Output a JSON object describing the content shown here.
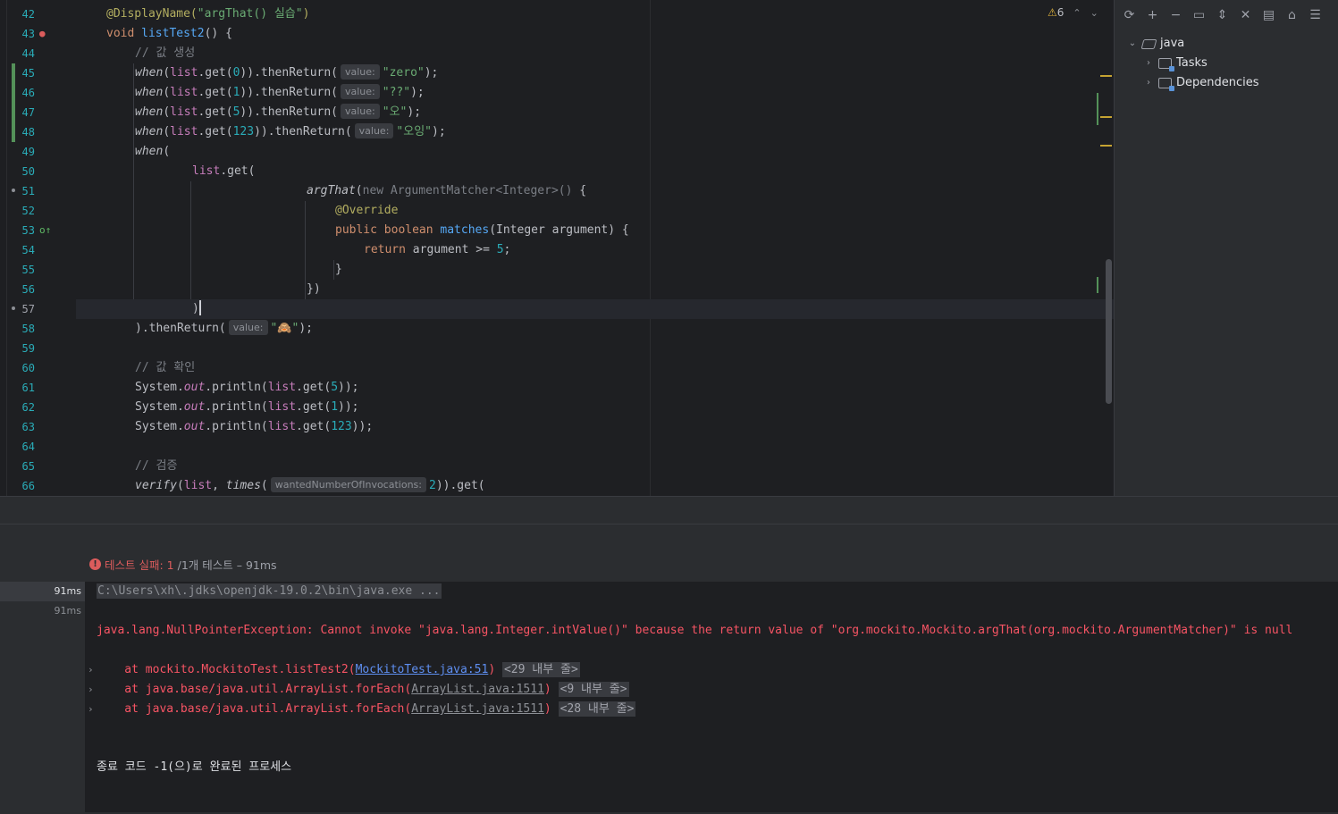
{
  "editor": {
    "lines": [
      {
        "n": "42",
        "html_parts": [
          [
            "ann",
            "@DisplayName("
          ],
          [
            "str",
            "\"argThat() 실습\""
          ],
          [
            "ann",
            ")"
          ]
        ],
        "indent": 34
      },
      {
        "n": "43",
        "html_parts": [
          [
            "kw",
            "void "
          ],
          [
            "fn",
            "listTest2"
          ],
          [
            "",
            "() {"
          ]
        ],
        "indent": 34
      },
      {
        "n": "44",
        "html_parts": [
          [
            "cmt",
            "// 값 생성"
          ]
        ],
        "indent": 66
      },
      {
        "n": "45",
        "html_parts": [
          [
            "it",
            "when"
          ],
          [
            "",
            "("
          ],
          [
            "fld",
            "list"
          ],
          [
            "",
            ".get("
          ],
          [
            "num",
            "0"
          ],
          [
            "",
            ")).thenReturn("
          ],
          [
            "hint",
            "value:"
          ],
          [
            "str",
            "\"zero\""
          ],
          [
            "",
            ");"
          ]
        ],
        "indent": 66
      },
      {
        "n": "46",
        "html_parts": [
          [
            "it",
            "when"
          ],
          [
            "",
            "("
          ],
          [
            "fld",
            "list"
          ],
          [
            "",
            ".get("
          ],
          [
            "num",
            "1"
          ],
          [
            "",
            ")).thenReturn("
          ],
          [
            "hint",
            "value:"
          ],
          [
            "str",
            "\"??\""
          ],
          [
            "",
            ");"
          ]
        ],
        "indent": 66
      },
      {
        "n": "47",
        "html_parts": [
          [
            "it",
            "when"
          ],
          [
            "",
            "("
          ],
          [
            "fld",
            "list"
          ],
          [
            "",
            ".get("
          ],
          [
            "num",
            "5"
          ],
          [
            "",
            ")).thenReturn("
          ],
          [
            "hint",
            "value:"
          ],
          [
            "str",
            "\"오\""
          ],
          [
            "",
            ");"
          ]
        ],
        "indent": 66
      },
      {
        "n": "48",
        "html_parts": [
          [
            "it",
            "when"
          ],
          [
            "",
            "("
          ],
          [
            "fld",
            "list"
          ],
          [
            "",
            ".get("
          ],
          [
            "num",
            "123"
          ],
          [
            "",
            ")).thenReturn("
          ],
          [
            "hint",
            "value:"
          ],
          [
            "str",
            "\"오잉\""
          ],
          [
            "",
            ");"
          ]
        ],
        "indent": 66
      },
      {
        "n": "49",
        "html_parts": [
          [
            "it",
            "when"
          ],
          [
            "",
            "("
          ]
        ],
        "indent": 66
      },
      {
        "n": "50",
        "html_parts": [
          [
            "fld",
            "list"
          ],
          [
            "",
            ".get("
          ]
        ],
        "indent": 130
      },
      {
        "n": "51",
        "html_parts": [
          [
            "it",
            "argThat"
          ],
          [
            "",
            "("
          ],
          [
            "cmt",
            "new ArgumentMatcher<Integer>()"
          ],
          [
            "",
            " {"
          ]
        ],
        "indent": 258
      },
      {
        "n": "52",
        "html_parts": [
          [
            "ann",
            "@Override"
          ]
        ],
        "indent": 290
      },
      {
        "n": "53",
        "html_parts": [
          [
            "kw",
            "public boolean "
          ],
          [
            "fn",
            "matches"
          ],
          [
            "",
            "(Integer argument) {"
          ]
        ],
        "indent": 290
      },
      {
        "n": "54",
        "html_parts": [
          [
            "kw",
            "return "
          ],
          [
            "",
            "argument >= "
          ],
          [
            "num",
            "5"
          ],
          [
            "",
            ";"
          ]
        ],
        "indent": 322
      },
      {
        "n": "55",
        "html_parts": [
          [
            "",
            "}"
          ]
        ],
        "indent": 290
      },
      {
        "n": "56",
        "html_parts": [
          [
            "",
            "})"
          ]
        ],
        "indent": 258
      },
      {
        "n": "57",
        "html_parts": [
          [
            "",
            ")"
          ],
          [
            "caret",
            ""
          ]
        ],
        "indent": 130
      },
      {
        "n": "58",
        "html_parts": [
          [
            "",
            ").thenReturn("
          ],
          [
            "hint",
            "value:"
          ],
          [
            "str",
            "\"🙈\""
          ],
          [
            "",
            ");"
          ]
        ],
        "indent": 66
      },
      {
        "n": "59",
        "html_parts": [],
        "indent": 66
      },
      {
        "n": "60",
        "html_parts": [
          [
            "cmt",
            "// 값 확인"
          ]
        ],
        "indent": 66
      },
      {
        "n": "61",
        "html_parts": [
          [
            "",
            "System."
          ],
          [
            "fld it",
            "out"
          ],
          [
            "",
            ".println("
          ],
          [
            "fld",
            "list"
          ],
          [
            "",
            ".get("
          ],
          [
            "num",
            "5"
          ],
          [
            "",
            "));"
          ]
        ],
        "indent": 66
      },
      {
        "n": "62",
        "html_parts": [
          [
            "",
            "System."
          ],
          [
            "fld it",
            "out"
          ],
          [
            "",
            ".println("
          ],
          [
            "fld",
            "list"
          ],
          [
            "",
            ".get("
          ],
          [
            "num",
            "1"
          ],
          [
            "",
            "));"
          ]
        ],
        "indent": 66
      },
      {
        "n": "63",
        "html_parts": [
          [
            "",
            "System."
          ],
          [
            "fld it",
            "out"
          ],
          [
            "",
            ".println("
          ],
          [
            "fld",
            "list"
          ],
          [
            "",
            ".get("
          ],
          [
            "num",
            "123"
          ],
          [
            "",
            "));"
          ]
        ],
        "indent": 66
      },
      {
        "n": "64",
        "html_parts": [],
        "indent": 66
      },
      {
        "n": "65",
        "html_parts": [
          [
            "cmt",
            "// 검증"
          ]
        ],
        "indent": 66
      },
      {
        "n": "66",
        "html_parts": [
          [
            "it",
            "verify"
          ],
          [
            "",
            "("
          ],
          [
            "fld",
            "list"
          ],
          [
            "",
            ", "
          ],
          [
            "it",
            "times"
          ],
          [
            "",
            "("
          ],
          [
            "hint",
            "wantedNumberOfInvocations:"
          ],
          [
            "num",
            "2"
          ],
          [
            "",
            ")).get("
          ]
        ],
        "indent": 66
      }
    ],
    "warnings": {
      "count": "6"
    }
  },
  "project": {
    "root": "java",
    "children": [
      "Tasks",
      "Dependencies"
    ]
  },
  "run": {
    "status_fail": "테스트 실패: 1",
    "status_meta": "/1개 테스트 – 91ms",
    "tree_times": [
      "91ms",
      "91ms"
    ],
    "cmd": "C:\\Users\\xh\\.jdks\\openjdk-19.0.2\\bin\\java.exe ...",
    "exception": "java.lang.NullPointerException: Cannot invoke \"java.lang.Integer.intValue()\" because the return value of \"org.mockito.Mockito.argThat(org.mockito.ArgumentMatcher)\" is null",
    "stack": [
      {
        "pre": "at mockito.MockitoTest.listTest2(",
        "link": "MockitoTest.java:51",
        "post": ")",
        "fold": "<29 내부 줄>",
        "primary": true
      },
      {
        "pre": "at java.base/java.util.ArrayList.forEach(",
        "link": "ArrayList.java:1511",
        "post": ")",
        "fold": "<9 내부 줄>",
        "primary": false
      },
      {
        "pre": "at java.base/java.util.ArrayList.forEach(",
        "link": "ArrayList.java:1511",
        "post": ")",
        "fold": "<28 내부 줄>",
        "primary": false
      }
    ],
    "exit": "종료 코드 -1(으)로 완료된 프로세스"
  }
}
